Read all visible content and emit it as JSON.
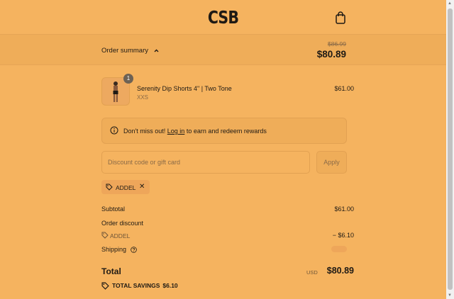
{
  "header": {
    "logo": "CSB",
    "cart_icon": "shopping-bag-icon"
  },
  "summary": {
    "toggle_label": "Order summary",
    "toggle_icon": "chevron-up-icon",
    "original_total": "$86.99",
    "current_total": "$80.89"
  },
  "product": {
    "quantity": "1",
    "name": "Serenity Dip Shorts 4\" | Two Tone",
    "variant": "XXS",
    "price": "$61.00"
  },
  "notice": {
    "icon": "info-icon",
    "prefix": "Don't miss out!",
    "link": "Log in",
    "suffix": "to earn and redeem rewards"
  },
  "discount": {
    "placeholder": "Discount code or gift card",
    "apply_label": "Apply",
    "applied_code": "ADDEL"
  },
  "totals": {
    "subtotal_label": "Subtotal",
    "subtotal_value": "$61.00",
    "order_discount_label": "Order discount",
    "discount_code": "ADDEL",
    "discount_value": "− $6.10",
    "shipping_label": "Shipping",
    "total_label": "Total",
    "currency": "USD",
    "total_value": "$80.89",
    "savings_label": "TOTAL SAVINGS",
    "savings_value": "$6.10"
  },
  "colors": {
    "background": "#f5b35f",
    "summary_bar": "#efad59",
    "border": "#e2a152",
    "text": "#1f1a14",
    "muted": "#8a6a47"
  }
}
